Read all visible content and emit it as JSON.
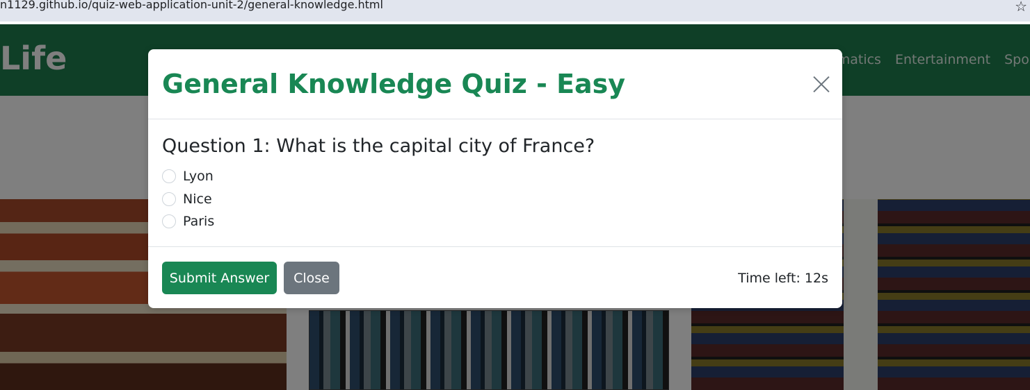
{
  "browser": {
    "url": "n1129.github.io/quiz-web-application-unit-2/general-knowledge.html",
    "bookmark_icon": "star-icon"
  },
  "navbar": {
    "brand": "Life",
    "links": [
      "hematics",
      "Entertainment",
      "Spo"
    ]
  },
  "modal": {
    "title": "General Knowledge Quiz - Easy",
    "close_icon": "close-icon",
    "question": "Question 1: What is the capital city of France?",
    "options": [
      "Lyon",
      "Nice",
      "Paris"
    ],
    "submit_label": "Submit Answer",
    "close_label": "Close",
    "timer": "Time left: 12s"
  },
  "colors": {
    "navbar": "#1e7e4f",
    "title": "#198754",
    "submit_button": "#198754",
    "close_button": "#6c757d"
  }
}
